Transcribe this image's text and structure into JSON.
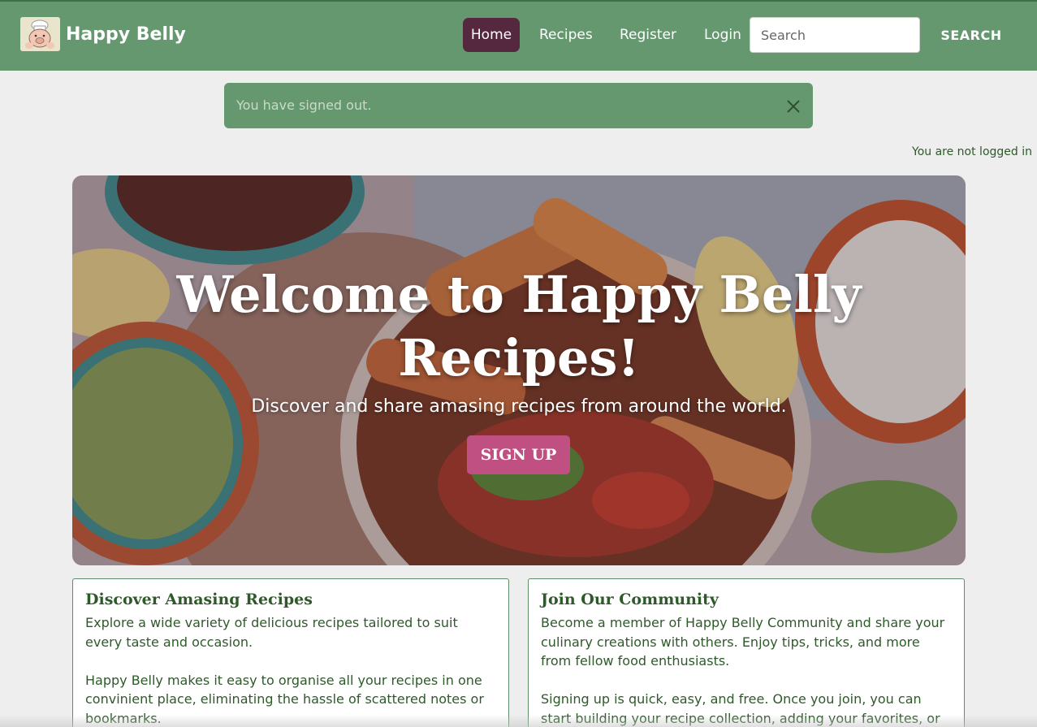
{
  "brand": {
    "name": "Happy Belly",
    "logo_icon": "chef-pig-logo-icon"
  },
  "nav": {
    "home": "Home",
    "recipes": "Recipes",
    "register": "Register",
    "login": "Login",
    "search_placeholder": "Search",
    "search_button": "SEARCH"
  },
  "alert": {
    "message": "You have signed out.",
    "close_icon": "close-icon"
  },
  "login_status": "You are not logged in",
  "hero": {
    "title": "Welcome to Happy Belly Recipes!",
    "subtitle": "Discover and share amasing recipes from around the world.",
    "button": "SIGN UP"
  },
  "cards": [
    {
      "title": "Discover Amasing Recipes",
      "paragraphs": [
        "Explore a wide variety of delicious recipes tailored to suit every taste and occasion.",
        "Happy Belly makes it easy to organise all your recipes in one convinient place, eliminating the hassle of scattered notes or bookmarks."
      ]
    },
    {
      "title": "Join Our Community",
      "paragraphs": [
        "Become a member of Happy Belly Community and share your culinary creations with others. Enjoy tips, tricks, and more from fellow food enthusiasts.",
        "Signing up is quick, easy, and free. Once you join, you can start building your recipe collection, adding your favorites, or"
      ]
    }
  ],
  "colors": {
    "navbar": "#65986f",
    "active_nav": "#55283f",
    "accent_button": "#c04f82",
    "text_green": "#2e5a2a"
  }
}
